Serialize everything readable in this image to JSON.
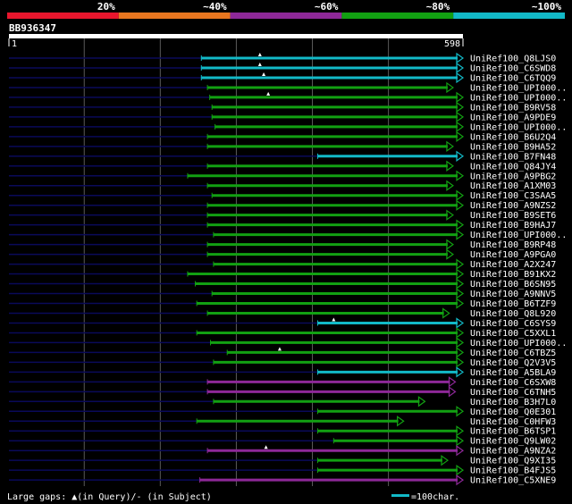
{
  "chart_data": {
    "type": "alignment-hits",
    "query_id": "BB936347",
    "query_start": "1",
    "query_end": "598",
    "query_length": 598,
    "identity_scale": [
      {
        "label": "20%",
        "color": "#e8162d"
      },
      {
        "label": "~40%",
        "color": "#e8761f"
      },
      {
        "label": "~60%",
        "color": "#8e2898"
      },
      {
        "label": "~80%",
        "color": "#12a012"
      },
      {
        "label": "~100%",
        "color": "#12b9c7"
      }
    ],
    "series": [
      {
        "name": "UniRef100_Q8LJS0",
        "start": 254,
        "end": 598,
        "color": "#12b9c7",
        "marks": [
          331
        ]
      },
      {
        "name": "UniRef100_C6SWD8",
        "start": 254,
        "end": 598,
        "color": "#12b9c7",
        "marks": [
          331
        ]
      },
      {
        "name": "UniRef100_C6TQQ9",
        "start": 254,
        "end": 598,
        "color": "#12b9c7",
        "marks": [
          336
        ]
      },
      {
        "name": "UniRef100_UPI000..",
        "start": 262,
        "end": 585,
        "color": "#12a012",
        "marks": []
      },
      {
        "name": "UniRef100_UPI000..",
        "start": 265,
        "end": 598,
        "color": "#12a012",
        "marks": [
          342
        ]
      },
      {
        "name": "UniRef100_B9RV58",
        "start": 268,
        "end": 598,
        "color": "#12a012",
        "marks": []
      },
      {
        "name": "UniRef100_A9PDE9",
        "start": 268,
        "end": 598,
        "color": "#12a012",
        "marks": []
      },
      {
        "name": "UniRef100_UPI000..",
        "start": 272,
        "end": 598,
        "color": "#12a012",
        "marks": []
      },
      {
        "name": "UniRef100_B6U2Q4",
        "start": 262,
        "end": 598,
        "color": "#12a012",
        "marks": []
      },
      {
        "name": "UniRef100_B9HA52",
        "start": 262,
        "end": 585,
        "color": "#12a012",
        "marks": []
      },
      {
        "name": "UniRef100_B7FN48",
        "start": 407,
        "end": 598,
        "color": "#12b9c7",
        "marks": []
      },
      {
        "name": "UniRef100_Q84JY4",
        "start": 262,
        "end": 585,
        "color": "#12a012",
        "marks": []
      },
      {
        "name": "UniRef100_A9PBG2",
        "start": 236,
        "end": 598,
        "color": "#12a012",
        "marks": []
      },
      {
        "name": "UniRef100_A1XM03",
        "start": 262,
        "end": 585,
        "color": "#12a012",
        "marks": []
      },
      {
        "name": "UniRef100_C3SAA5",
        "start": 268,
        "end": 598,
        "color": "#12a012",
        "marks": []
      },
      {
        "name": "UniRef100_A9NZS2",
        "start": 262,
        "end": 598,
        "color": "#12a012",
        "marks": []
      },
      {
        "name": "UniRef100_B9SET6",
        "start": 262,
        "end": 585,
        "color": "#12a012",
        "marks": []
      },
      {
        "name": "UniRef100_B9HAJ7",
        "start": 262,
        "end": 598,
        "color": "#12a012",
        "marks": []
      },
      {
        "name": "UniRef100_UPI000..",
        "start": 270,
        "end": 598,
        "color": "#12a012",
        "marks": []
      },
      {
        "name": "UniRef100_B9RP48",
        "start": 262,
        "end": 585,
        "color": "#12a012",
        "marks": []
      },
      {
        "name": "UniRef100_A9PGA0",
        "start": 262,
        "end": 585,
        "color": "#12a012",
        "marks": []
      },
      {
        "name": "UniRef100_A2X247",
        "start": 270,
        "end": 598,
        "color": "#12a012",
        "marks": []
      },
      {
        "name": "UniRef100_B91KX2",
        "start": 236,
        "end": 598,
        "color": "#12a012",
        "marks": []
      },
      {
        "name": "UniRef100_B6SN95",
        "start": 246,
        "end": 598,
        "color": "#12a012",
        "marks": []
      },
      {
        "name": "UniRef100_A9NNV5",
        "start": 268,
        "end": 598,
        "color": "#12a012",
        "marks": []
      },
      {
        "name": "UniRef100_B6TZF9",
        "start": 248,
        "end": 598,
        "color": "#12a012",
        "marks": []
      },
      {
        "name": "UniRef100_Q8L920",
        "start": 262,
        "end": 580,
        "color": "#12a012",
        "marks": []
      },
      {
        "name": "UniRef100_C6SYS9",
        "start": 407,
        "end": 598,
        "color": "#12b9c7",
        "marks": [
          428
        ]
      },
      {
        "name": "UniRef100_C5XXL1",
        "start": 248,
        "end": 598,
        "color": "#12a012",
        "marks": []
      },
      {
        "name": "UniRef100_UPI000..",
        "start": 266,
        "end": 598,
        "color": "#12a012",
        "marks": []
      },
      {
        "name": "UniRef100_C6TBZ5",
        "start": 288,
        "end": 598,
        "color": "#12a012",
        "marks": [
          357
        ]
      },
      {
        "name": "UniRef100_Q2V3V5",
        "start": 270,
        "end": 598,
        "color": "#12a012",
        "marks": []
      },
      {
        "name": "UniRef100_A5BLA9",
        "start": 407,
        "end": 598,
        "color": "#12b9c7",
        "marks": []
      },
      {
        "name": "UniRef100_C6SXW8",
        "start": 262,
        "end": 588,
        "color": "#8e2898",
        "marks": []
      },
      {
        "name": "UniRef100_C6TNH5",
        "start": 262,
        "end": 588,
        "color": "#8e2898",
        "marks": []
      },
      {
        "name": "UniRef100_B3H7L0",
        "start": 270,
        "end": 548,
        "color": "#12a012",
        "marks": []
      },
      {
        "name": "UniRef100_Q0E301",
        "start": 407,
        "end": 598,
        "color": "#12a012",
        "marks": []
      },
      {
        "name": "UniRef100_C0HFW3",
        "start": 248,
        "end": 520,
        "color": "#12a012",
        "marks": []
      },
      {
        "name": "UniRef100_B6TSP1",
        "start": 407,
        "end": 598,
        "color": "#12a012",
        "marks": []
      },
      {
        "name": "UniRef100_Q9LW02",
        "start": 428,
        "end": 598,
        "color": "#12a012",
        "marks": []
      },
      {
        "name": "UniRef100_A9NZA2",
        "start": 262,
        "end": 598,
        "color": "#8e2898",
        "marks": [
          339
        ]
      },
      {
        "name": "UniRef100_Q9XI35",
        "start": 407,
        "end": 578,
        "color": "#12a012",
        "marks": []
      },
      {
        "name": "UniRef100_B4FJS5",
        "start": 407,
        "end": 598,
        "color": "#12a012",
        "marks": []
      },
      {
        "name": "UniRef100_C5XNE9",
        "start": 252,
        "end": 598,
        "color": "#8e2898",
        "marks": []
      }
    ]
  },
  "legend": {
    "gaps_text": "Large gaps: ▲(in Query)/- (in Subject)",
    "scale_text": "=100char.",
    "scale_chars": 100,
    "scale_color": "#12b9c7"
  },
  "colors": {
    "background": "#000000",
    "query_bar": "#ffffff",
    "unaligned": "#0a0a5a",
    "gridline": "#5a5a5a"
  }
}
